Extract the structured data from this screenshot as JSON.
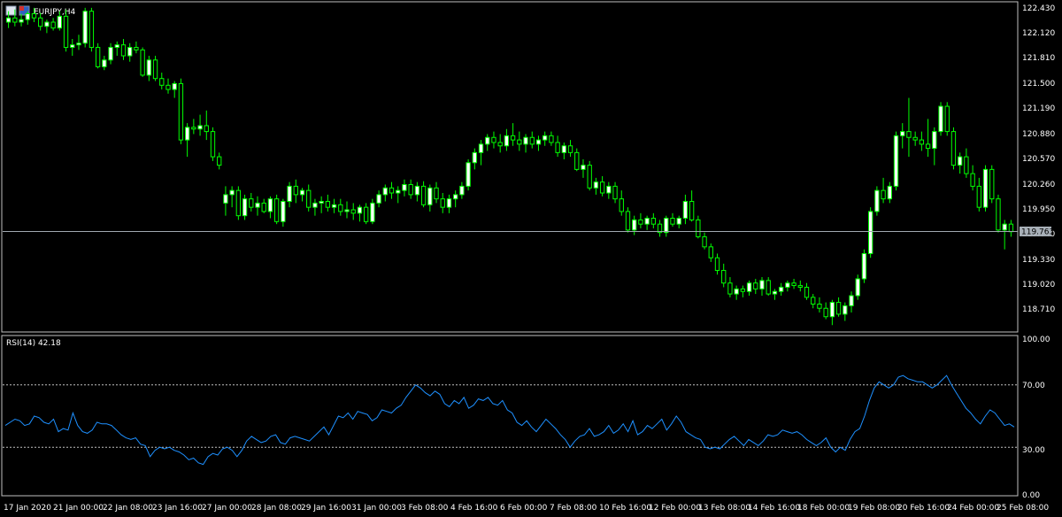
{
  "window": {
    "symbol_title": "EURJPY,H4",
    "rsi_label": "RSI(14) 42.18"
  },
  "colors": {
    "background": "#000000",
    "bull_candle_body": "#ffffff",
    "bull_candle_wick": "#00ff00",
    "bear_candle_body": "#000000",
    "bear_candle_outline": "#00ff00",
    "rsi_line": "#1e90ff",
    "current_price_line": "#a0a8b0",
    "grid_level": "#c0c0c0",
    "axis_text": "#ffffff"
  },
  "price_axis": {
    "ticks": [
      "122.430",
      "122.120",
      "121.810",
      "121.500",
      "121.190",
      "120.880",
      "120.570",
      "120.260",
      "119.950",
      "119.640",
      "119.330",
      "119.020",
      "118.710"
    ],
    "current_price": "119.763"
  },
  "rsi_axis": {
    "ticks": [
      "100.00",
      "70.00",
      "30.00",
      "0.00"
    ],
    "levels": [
      70,
      30
    ]
  },
  "time_axis": {
    "ticks": [
      "17 Jan 2020",
      "21 Jan 00:00",
      "22 Jan 08:00",
      "23 Jan 16:00",
      "27 Jan 00:00",
      "28 Jan 08:00",
      "29 Jan 16:00",
      "31 Jan 00:00",
      "3 Feb 08:00",
      "4 Feb 16:00",
      "6 Feb 00:00",
      "7 Feb 08:00",
      "10 Feb 16:00",
      "12 Feb 00:00",
      "13 Feb 08:00",
      "14 Feb 16:00",
      "18 Feb 00:00",
      "19 Feb 08:00",
      "20 Feb 16:00",
      "24 Feb 00:00",
      "25 Feb 08:00"
    ]
  },
  "chart_data": [
    {
      "type": "candlestick",
      "symbol": "EURJPY",
      "timeframe": "H4",
      "ylim": [
        118.6,
        122.45
      ],
      "current_price": 119.763,
      "ohlc": [
        [
          122.25,
          122.38,
          122.18,
          122.3
        ],
        [
          122.3,
          122.4,
          122.2,
          122.25
        ],
        [
          122.25,
          122.35,
          122.2,
          122.28
        ],
        [
          122.28,
          122.38,
          122.22,
          122.35
        ],
        [
          122.35,
          122.42,
          122.25,
          122.3
        ],
        [
          122.3,
          122.36,
          122.15,
          122.2
        ],
        [
          122.2,
          122.28,
          122.12,
          122.25
        ],
        [
          122.25,
          122.3,
          122.15,
          122.18
        ],
        [
          122.18,
          122.38,
          122.15,
          122.32
        ],
        [
          122.32,
          122.4,
          121.9,
          121.95
        ],
        [
          121.95,
          122.05,
          121.85,
          121.98
        ],
        [
          121.98,
          122.1,
          121.92,
          122.0
        ],
        [
          122.0,
          122.42,
          121.95,
          122.38
        ],
        [
          122.38,
          122.42,
          121.9,
          121.95
        ],
        [
          121.95,
          122.0,
          121.7,
          121.72
        ],
        [
          121.72,
          121.85,
          121.68,
          121.8
        ],
        [
          121.8,
          122.0,
          121.75,
          121.95
        ],
        [
          121.95,
          122.02,
          121.85,
          121.98
        ],
        [
          121.98,
          122.05,
          121.8,
          121.85
        ],
        [
          121.85,
          122.0,
          121.78,
          121.95
        ],
        [
          121.95,
          122.02,
          121.88,
          121.92
        ],
        [
          121.92,
          121.95,
          121.6,
          121.62
        ],
        [
          121.62,
          121.85,
          121.55,
          121.8
        ],
        [
          121.8,
          121.85,
          121.55,
          121.58
        ],
        [
          121.58,
          121.65,
          121.45,
          121.5
        ],
        [
          121.5,
          121.58,
          121.4,
          121.45
        ],
        [
          121.45,
          121.55,
          121.35,
          121.52
        ],
        [
          121.52,
          121.58,
          120.8,
          120.85
        ],
        [
          120.85,
          121.05,
          120.65,
          121.0
        ],
        [
          121.0,
          121.1,
          120.92,
          120.98
        ],
        [
          120.98,
          121.15,
          120.9,
          121.02
        ],
        [
          121.02,
          121.2,
          120.85,
          120.95
        ],
        [
          120.95,
          121.0,
          120.6,
          120.65
        ],
        [
          120.65,
          120.7,
          120.5,
          120.55
        ],
        [
          120.1,
          120.3,
          119.95,
          120.2
        ],
        [
          120.2,
          120.3,
          120.05,
          120.25
        ],
        [
          120.25,
          120.3,
          119.9,
          119.95
        ],
        [
          119.95,
          120.2,
          119.9,
          120.15
        ],
        [
          120.15,
          120.22,
          120.0,
          120.05
        ],
        [
          120.05,
          120.18,
          119.95,
          120.1
        ],
        [
          120.1,
          120.15,
          119.98,
          120.0
        ],
        [
          120.0,
          120.18,
          119.92,
          120.15
        ],
        [
          120.15,
          120.2,
          119.85,
          119.88
        ],
        [
          119.88,
          120.15,
          119.82,
          120.12
        ],
        [
          120.12,
          120.35,
          120.05,
          120.3
        ],
        [
          120.3,
          120.38,
          120.1,
          120.2
        ],
        [
          120.2,
          120.28,
          120.12,
          120.25
        ],
        [
          120.25,
          120.32,
          120.0,
          120.05
        ],
        [
          120.05,
          120.15,
          119.95,
          120.1
        ],
        [
          120.1,
          120.18,
          119.98,
          120.12
        ],
        [
          120.12,
          120.2,
          120.0,
          120.05
        ],
        [
          120.05,
          120.15,
          119.98,
          120.08
        ],
        [
          120.08,
          120.15,
          119.95,
          120.0
        ],
        [
          120.0,
          120.12,
          119.92,
          120.02
        ],
        [
          120.02,
          120.1,
          119.9,
          119.98
        ],
        [
          119.98,
          120.08,
          119.88,
          120.05
        ],
        [
          120.05,
          120.1,
          119.85,
          119.88
        ],
        [
          119.88,
          120.15,
          119.85,
          120.1
        ],
        [
          120.1,
          120.25,
          120.05,
          120.2
        ],
        [
          120.2,
          120.32,
          120.12,
          120.28
        ],
        [
          120.28,
          120.35,
          120.15,
          120.22
        ],
        [
          120.22,
          120.3,
          120.1,
          120.25
        ],
        [
          120.25,
          120.38,
          120.18,
          120.32
        ],
        [
          120.32,
          120.38,
          120.15,
          120.2
        ],
        [
          120.2,
          120.35,
          120.12,
          120.3
        ],
        [
          120.3,
          120.36,
          120.05,
          120.08
        ],
        [
          120.08,
          120.32,
          120.0,
          120.28
        ],
        [
          120.28,
          120.35,
          120.1,
          120.15
        ],
        [
          120.15,
          120.22,
          119.98,
          120.05
        ],
        [
          120.05,
          120.2,
          119.98,
          120.15
        ],
        [
          120.15,
          120.25,
          120.05,
          120.2
        ],
        [
          120.2,
          120.35,
          120.15,
          120.3
        ],
        [
          120.3,
          120.62,
          120.25,
          120.58
        ],
        [
          120.58,
          120.75,
          120.5,
          120.7
        ],
        [
          120.7,
          120.85,
          120.55,
          120.8
        ],
        [
          120.8,
          120.92,
          120.72,
          120.88
        ],
        [
          120.88,
          120.95,
          120.75,
          120.82
        ],
        [
          120.82,
          120.92,
          120.7,
          120.78
        ],
        [
          120.78,
          120.98,
          120.72,
          120.9
        ],
        [
          120.9,
          121.05,
          120.78,
          120.85
        ],
        [
          120.85,
          120.95,
          120.72,
          120.8
        ],
        [
          120.8,
          120.92,
          120.7,
          120.88
        ],
        [
          120.88,
          120.95,
          120.75,
          120.8
        ],
        [
          120.8,
          120.9,
          120.72,
          120.85
        ],
        [
          120.85,
          120.95,
          120.78,
          120.9
        ],
        [
          120.9,
          120.95,
          120.78,
          120.82
        ],
        [
          120.82,
          120.9,
          120.65,
          120.7
        ],
        [
          120.7,
          120.82,
          120.62,
          120.78
        ],
        [
          120.78,
          120.85,
          120.65,
          120.7
        ],
        [
          120.7,
          120.75,
          120.48,
          120.5
        ],
        [
          120.5,
          120.62,
          120.4,
          120.55
        ],
        [
          120.55,
          120.6,
          120.25,
          120.28
        ],
        [
          120.28,
          120.4,
          120.2,
          120.35
        ],
        [
          120.35,
          120.42,
          120.18,
          120.22
        ],
        [
          120.22,
          120.35,
          120.15,
          120.3
        ],
        [
          120.3,
          120.35,
          120.1,
          120.15
        ],
        [
          120.15,
          120.25,
          119.95,
          120.0
        ],
        [
          120.0,
          120.05,
          119.75,
          119.78
        ],
        [
          119.78,
          119.95,
          119.72,
          119.9
        ],
        [
          119.9,
          119.98,
          119.8,
          119.85
        ],
        [
          119.85,
          119.95,
          119.78,
          119.92
        ],
        [
          119.92,
          119.98,
          119.8,
          119.85
        ],
        [
          119.85,
          119.9,
          119.7,
          119.75
        ],
        [
          119.75,
          119.95,
          119.7,
          119.92
        ],
        [
          119.92,
          119.98,
          119.82,
          119.85
        ],
        [
          119.85,
          119.95,
          119.8,
          119.92
        ],
        [
          119.92,
          120.2,
          119.85,
          120.12
        ],
        [
          120.12,
          120.25,
          119.88,
          119.9
        ],
        [
          119.9,
          119.95,
          119.68,
          119.7
        ],
        [
          119.7,
          119.75,
          119.55,
          119.58
        ],
        [
          119.58,
          119.62,
          119.4,
          119.45
        ],
        [
          119.45,
          119.5,
          119.25,
          119.3
        ],
        [
          119.3,
          119.38,
          119.1,
          119.15
        ],
        [
          119.15,
          119.22,
          118.98,
          119.02
        ],
        [
          119.02,
          119.12,
          118.95,
          119.08
        ],
        [
          119.08,
          119.12,
          118.98,
          119.05
        ],
        [
          119.05,
          119.18,
          119.0,
          119.15
        ],
        [
          119.15,
          119.2,
          119.02,
          119.08
        ],
        [
          119.08,
          119.22,
          119.0,
          119.18
        ],
        [
          119.18,
          119.22,
          119.0,
          119.02
        ],
        [
          119.02,
          119.08,
          118.95,
          119.05
        ],
        [
          119.05,
          119.15,
          119.0,
          119.1
        ],
        [
          119.1,
          119.18,
          119.05,
          119.15
        ],
        [
          119.15,
          119.2,
          119.08,
          119.12
        ],
        [
          119.12,
          119.18,
          119.05,
          119.1
        ],
        [
          119.1,
          119.15,
          118.95,
          118.98
        ],
        [
          118.98,
          119.02,
          118.85,
          118.9
        ],
        [
          118.9,
          118.98,
          118.8,
          118.85
        ],
        [
          118.85,
          118.92,
          118.72,
          118.75
        ],
        [
          118.75,
          118.95,
          118.65,
          118.92
        ],
        [
          118.92,
          118.98,
          118.75,
          118.78
        ],
        [
          118.78,
          118.92,
          118.7,
          118.88
        ],
        [
          118.88,
          119.05,
          118.8,
          119.0
        ],
        [
          119.0,
          119.25,
          118.95,
          119.2
        ],
        [
          119.2,
          119.55,
          119.15,
          119.5
        ],
        [
          119.5,
          120.05,
          119.45,
          120.0
        ],
        [
          120.0,
          120.3,
          119.95,
          120.25
        ],
        [
          120.25,
          120.4,
          120.1,
          120.15
        ],
        [
          120.15,
          120.35,
          120.1,
          120.3
        ],
        [
          120.3,
          120.95,
          120.25,
          120.9
        ],
        [
          120.9,
          121.05,
          120.75,
          120.95
        ],
        [
          120.95,
          121.35,
          120.65,
          120.88
        ],
        [
          120.88,
          120.95,
          120.78,
          120.85
        ],
        [
          120.85,
          120.95,
          120.72,
          120.8
        ],
        [
          120.8,
          121.1,
          120.65,
          120.75
        ],
        [
          120.75,
          121.0,
          120.55,
          120.95
        ],
        [
          120.95,
          121.3,
          120.9,
          121.25
        ],
        [
          121.25,
          121.3,
          120.9,
          120.95
        ],
        [
          120.95,
          121.0,
          120.5,
          120.55
        ],
        [
          120.55,
          120.7,
          120.45,
          120.65
        ],
        [
          120.65,
          120.75,
          120.4,
          120.45
        ],
        [
          120.45,
          120.55,
          120.25,
          120.3
        ],
        [
          120.3,
          120.4,
          120.0,
          120.05
        ],
        [
          120.05,
          120.55,
          120.0,
          120.5
        ],
        [
          120.5,
          120.55,
          120.1,
          120.15
        ],
        [
          120.15,
          120.2,
          119.75,
          119.78
        ],
        [
          119.78,
          119.9,
          119.55,
          119.85
        ],
        [
          119.85,
          119.9,
          119.7,
          119.76
        ]
      ]
    },
    {
      "type": "line",
      "name": "RSI(14) 42.18",
      "ylim": [
        0,
        100
      ],
      "levels": [
        70,
        30
      ],
      "last_value": 42.18,
      "values": [
        44,
        46,
        48,
        47,
        44,
        45,
        50,
        49,
        46,
        45,
        48,
        40,
        42,
        41,
        52,
        44,
        40,
        39,
        41,
        46,
        45,
        45,
        44,
        41,
        38,
        36,
        35,
        36,
        32,
        31,
        24,
        28,
        30,
        29,
        30,
        28,
        27,
        25,
        22,
        23,
        20,
        19,
        24,
        26,
        25,
        29,
        30,
        28,
        24,
        28,
        34,
        37,
        35,
        33,
        34,
        37,
        38,
        33,
        32,
        36,
        37,
        36,
        35,
        34,
        37,
        40,
        43,
        38,
        44,
        50,
        49,
        52,
        48,
        53,
        52,
        51,
        47,
        49,
        54,
        53,
        52,
        55,
        57,
        62,
        66,
        70,
        68,
        65,
        63,
        66,
        64,
        58,
        56,
        60,
        58,
        62,
        55,
        57,
        61,
        60,
        62,
        58,
        57,
        60,
        54,
        52,
        46,
        44,
        47,
        43,
        40,
        44,
        48,
        45,
        42,
        38,
        35,
        30,
        34,
        37,
        38,
        42,
        37,
        38,
        40,
        44,
        39,
        41,
        45,
        40,
        47,
        38,
        40,
        44,
        42,
        45,
        48,
        41,
        45,
        50,
        46,
        40,
        38,
        36,
        35,
        30,
        29,
        30,
        29,
        32,
        35,
        37,
        34,
        31,
        35,
        33,
        31,
        34,
        38,
        37,
        38,
        41,
        40,
        39,
        40,
        38,
        35,
        33,
        31,
        33,
        36,
        30,
        27,
        30,
        28,
        35,
        40,
        42,
        50,
        60,
        68,
        72,
        70,
        68,
        70,
        75,
        76,
        74,
        73,
        72,
        72,
        70,
        68,
        70,
        73,
        76,
        70,
        65,
        60,
        55,
        52,
        48,
        45,
        50,
        54,
        52,
        48,
        44,
        45,
        43
      ]
    }
  ]
}
